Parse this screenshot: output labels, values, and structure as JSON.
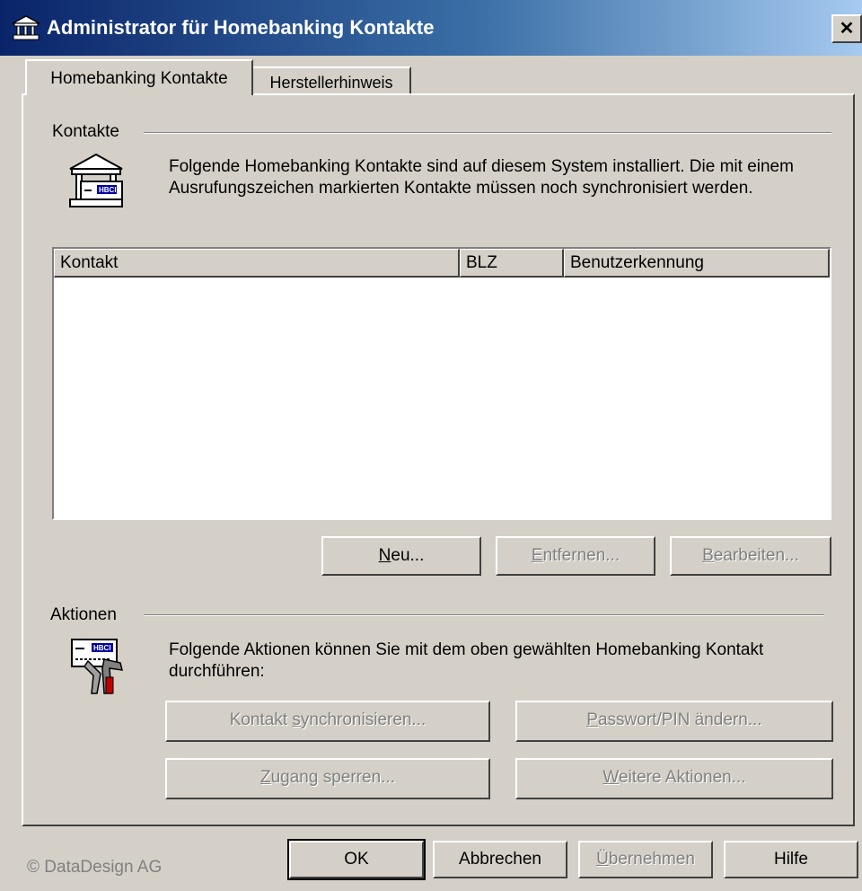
{
  "window": {
    "title": "Administrator für Homebanking Kontakte",
    "close_glyph": "✕"
  },
  "tabs": [
    {
      "label": "Homebanking Kontakte",
      "active": true
    },
    {
      "label": "Herstellerhinweis",
      "active": false
    }
  ],
  "kontakte": {
    "group_label": "Kontakte",
    "icon": "bank-building-icon",
    "description": "Folgende Homebanking Kontakte sind auf diesem System installiert. Die mit einem Ausrufungszeichen markierten Kontakte müssen noch synchronisiert werden.",
    "columns": [
      "Kontakt",
      "BLZ",
      "Benutzerkennung"
    ],
    "rows": [],
    "buttons": {
      "neu": {
        "pre": "",
        "mn": "N",
        "post": "eu..."
      },
      "entfernen": {
        "pre": "",
        "mn": "E",
        "post": "ntfernen..."
      },
      "bearbeiten": {
        "pre": "",
        "mn": "B",
        "post": "earbeiten..."
      }
    }
  },
  "aktionen": {
    "group_label": "Aktionen",
    "icon": "card-tools-icon",
    "description": "Folgende Aktionen können Sie mit dem oben gewählten Homebanking Kontakt durchführen:",
    "buttons": {
      "sync": {
        "pre": "Kontakt ",
        "mn": "s",
        "post": "ynchronisieren..."
      },
      "passwort": {
        "pre": "",
        "mn": "P",
        "post": "asswort/PIN ändern..."
      },
      "sperren": {
        "pre": "",
        "mn": "Z",
        "post": "ugang sperren..."
      },
      "weitere": {
        "pre": "",
        "mn": "W",
        "post": "eitere Aktionen..."
      }
    }
  },
  "footer": {
    "copyright": "© DataDesign AG",
    "ok": "OK",
    "abbrechen": "Abbrechen",
    "uebernehmen": {
      "pre": "",
      "mn": "Ü",
      "post": "bernehmen"
    },
    "hilfe": "Hilfe"
  },
  "colors": {
    "titlebar_start": "#0a246a",
    "titlebar_end": "#a6caf0",
    "face": "#d4d0c8",
    "disabled_text": "#808080"
  }
}
